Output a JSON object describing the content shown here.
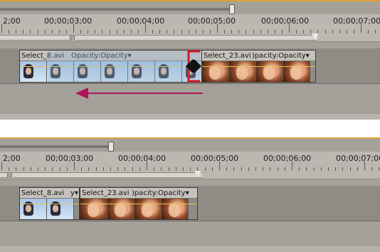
{
  "panels": [
    {
      "id": "before",
      "timecodes": [
        "2;00",
        "00;00;03;00",
        "00;00;04;00",
        "00;00;05;00",
        "00;00;06;00",
        "00;00;07;00"
      ],
      "clips": [
        {
          "name": "Select_8.avi",
          "opacity": "Opacity:Opacity",
          "kind": "blue"
        },
        {
          "name": "Select_23.avi",
          "opacity": ")pacity:Opacity",
          "kind": "warm"
        }
      ]
    },
    {
      "id": "after",
      "timecodes": [
        "2;00",
        "00;00;03;00",
        "00;00;04;00",
        "00;00;05;00",
        "00;00;06;00",
        "00;00;07;00"
      ],
      "clips": [
        {
          "name": "Select_8.avi",
          "opacity": "y",
          "kind": "blue"
        },
        {
          "name": "Select_23.avi",
          "opacity": ")pacity:Opacity",
          "kind": "warm"
        }
      ]
    }
  ],
  "colors": {
    "accent_arrow": "#b0155f",
    "ripple_bracket": "#d3182a",
    "timeline_orange": "#e0a036"
  },
  "icons": {
    "ripple_edit": "ripple-edit-tool-icon",
    "drag_direction": "left-arrow-icon",
    "menu": "chevron-down-icon"
  }
}
